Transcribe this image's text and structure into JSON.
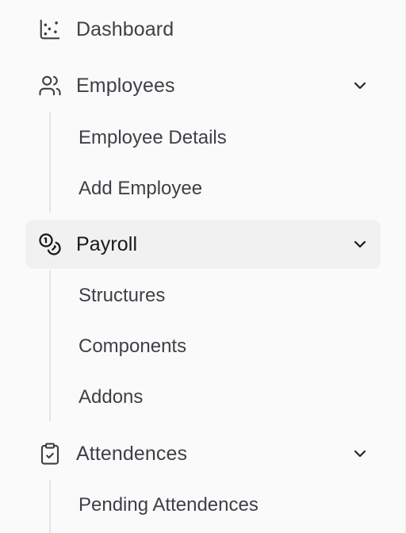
{
  "nav": {
    "items": [
      {
        "label": "Dashboard",
        "icon": "chart-scatter-icon",
        "expandable": false,
        "active": false,
        "subitems": []
      },
      {
        "label": "Employees",
        "icon": "users-icon",
        "expandable": true,
        "active": false,
        "subitems": [
          {
            "label": "Employee Details"
          },
          {
            "label": "Add Employee"
          }
        ]
      },
      {
        "label": "Payroll",
        "icon": "coins-icon",
        "expandable": true,
        "active": true,
        "subitems": [
          {
            "label": "Structures"
          },
          {
            "label": "Components"
          },
          {
            "label": "Addons"
          }
        ]
      },
      {
        "label": "Attendences",
        "icon": "clipboard-check-icon",
        "expandable": true,
        "active": false,
        "subitems": [
          {
            "label": "Pending Attendences"
          }
        ]
      }
    ]
  },
  "colors": {
    "background": "#fafafa",
    "active_background": "#f1f1f2",
    "text": "#3f3f46",
    "active_text": "#18181b",
    "guide_line": "#e4e4e7"
  }
}
